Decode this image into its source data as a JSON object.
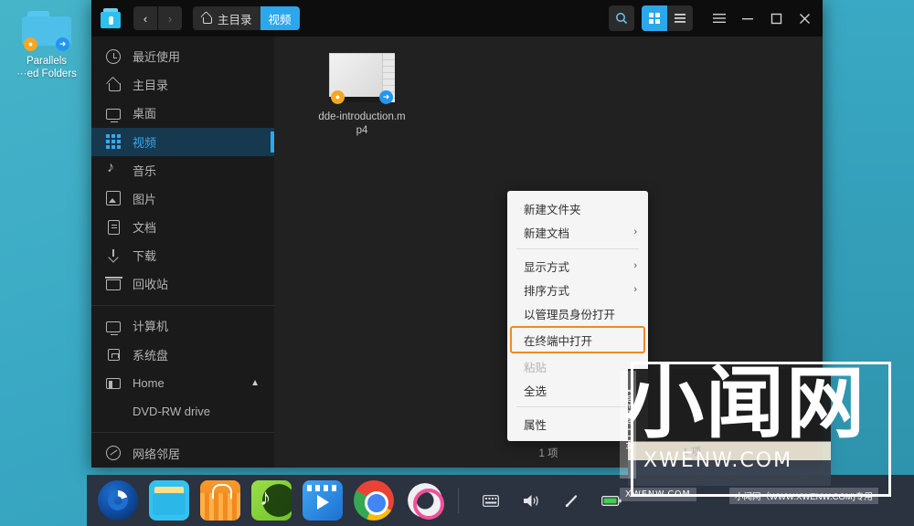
{
  "desktop": {
    "icon": {
      "label_line1": "Parallels",
      "label_line2": "···ed Folders",
      "lock_badge": "lock-icon",
      "share_badge": "share-icon"
    }
  },
  "window": {
    "app_icon": "file-manager-icon",
    "nav": {
      "back": "‹",
      "forward": "›"
    },
    "breadcrumb": [
      {
        "label": "主目录",
        "icon": "home-icon",
        "active": false
      },
      {
        "label": "视频",
        "icon": "",
        "active": true
      }
    ],
    "toolbar": {
      "search": "search-icon",
      "icon_view": "grid-view-icon",
      "list_view": "list-view-icon",
      "menu": "hamburger-menu-icon",
      "minimize": "minimize-icon",
      "maximize": "maximize-icon",
      "close": "close-icon"
    }
  },
  "sidebar": {
    "group1": [
      {
        "label": "最近使用",
        "icon": "clock-icon",
        "selected": false
      },
      {
        "label": "主目录",
        "icon": "home-icon",
        "selected": false
      },
      {
        "label": "桌面",
        "icon": "monitor-icon",
        "selected": false
      },
      {
        "label": "视频",
        "icon": "video-grid-icon",
        "selected": true
      },
      {
        "label": "音乐",
        "icon": "music-note-icon",
        "selected": false
      },
      {
        "label": "图片",
        "icon": "picture-icon",
        "selected": false
      },
      {
        "label": "文档",
        "icon": "document-icon",
        "selected": false
      },
      {
        "label": "下载",
        "icon": "download-icon",
        "selected": false
      },
      {
        "label": "回收站",
        "icon": "trash-icon",
        "selected": false
      }
    ],
    "group2": [
      {
        "label": "计算机",
        "icon": "computer-icon",
        "eject": false
      },
      {
        "label": "系统盘",
        "icon": "disk-icon",
        "eject": false
      },
      {
        "label": "Home",
        "icon": "folder-drive-icon",
        "eject": true
      },
      {
        "label": "DVD-RW drive",
        "icon": "",
        "eject": false
      }
    ],
    "group3": [
      {
        "label": "网络邻居",
        "icon": "network-icon"
      }
    ]
  },
  "content": {
    "file": {
      "name": "dde-introduction.mp4",
      "thumbnail": "video-thumbnail",
      "lock_badge": "lock-icon",
      "share_badge": "share-icon"
    },
    "status": "1 项"
  },
  "context_menu": {
    "items": [
      {
        "label": "新建文件夹",
        "submenu": false,
        "disabled": false,
        "highlighted": false
      },
      {
        "label": "新建文档",
        "submenu": true,
        "disabled": false,
        "highlighted": false
      },
      {
        "separator": true
      },
      {
        "label": "显示方式",
        "submenu": true,
        "disabled": false,
        "highlighted": false
      },
      {
        "label": "排序方式",
        "submenu": true,
        "disabled": false,
        "highlighted": false
      },
      {
        "label": "以管理员身份打开",
        "submenu": false,
        "disabled": false,
        "highlighted": false
      },
      {
        "label": "在终端中打开",
        "submenu": false,
        "disabled": false,
        "highlighted": true
      },
      {
        "label": "粘贴",
        "submenu": false,
        "disabled": true,
        "highlighted": false
      },
      {
        "label": "全选",
        "submenu": false,
        "disabled": false,
        "highlighted": false
      },
      {
        "separator": true
      },
      {
        "label": "属性",
        "submenu": false,
        "disabled": false,
        "highlighted": false
      }
    ],
    "submenu_arrow": "›",
    "highlight_color": "#ef8a24"
  },
  "dock": {
    "apps": [
      {
        "name": "launcher",
        "title": "启动器"
      },
      {
        "name": "file-manager",
        "title": "文件管理器"
      },
      {
        "name": "app-store",
        "title": "应用商店"
      },
      {
        "name": "music-player",
        "title": "音乐"
      },
      {
        "name": "video-player",
        "title": "影院"
      },
      {
        "name": "chrome",
        "title": "Chrome"
      },
      {
        "name": "settings",
        "title": "控制中心"
      }
    ],
    "tray": [
      {
        "name": "keyboard-icon",
        "glyph": "⌨"
      },
      {
        "name": "volume-icon",
        "glyph": "🔊"
      },
      {
        "name": "brightness-icon",
        "glyph": "✎"
      },
      {
        "name": "battery-icon",
        "glyph": "▭"
      }
    ]
  },
  "watermark": {
    "main": "小闻网",
    "sub": "XWENW.COM",
    "side": "XWENW.COM",
    "tag_left": "XWENW.COM",
    "tag_right": "小闻网（WWW.XWENW.COM)专用",
    "inner_status": "1 项"
  },
  "colors": {
    "desktop": "#3fb0c8",
    "window_bg": "#212121",
    "sidebar_bg": "#1a1a1a",
    "titlebar_bg": "#0d0d0d",
    "accent_blue": "#2ca7ec",
    "selected_row": "#16394f",
    "menu_bg": "#f5f5f5",
    "highlight_orange": "#ef8a24",
    "dock_bg": "#2b3240"
  }
}
